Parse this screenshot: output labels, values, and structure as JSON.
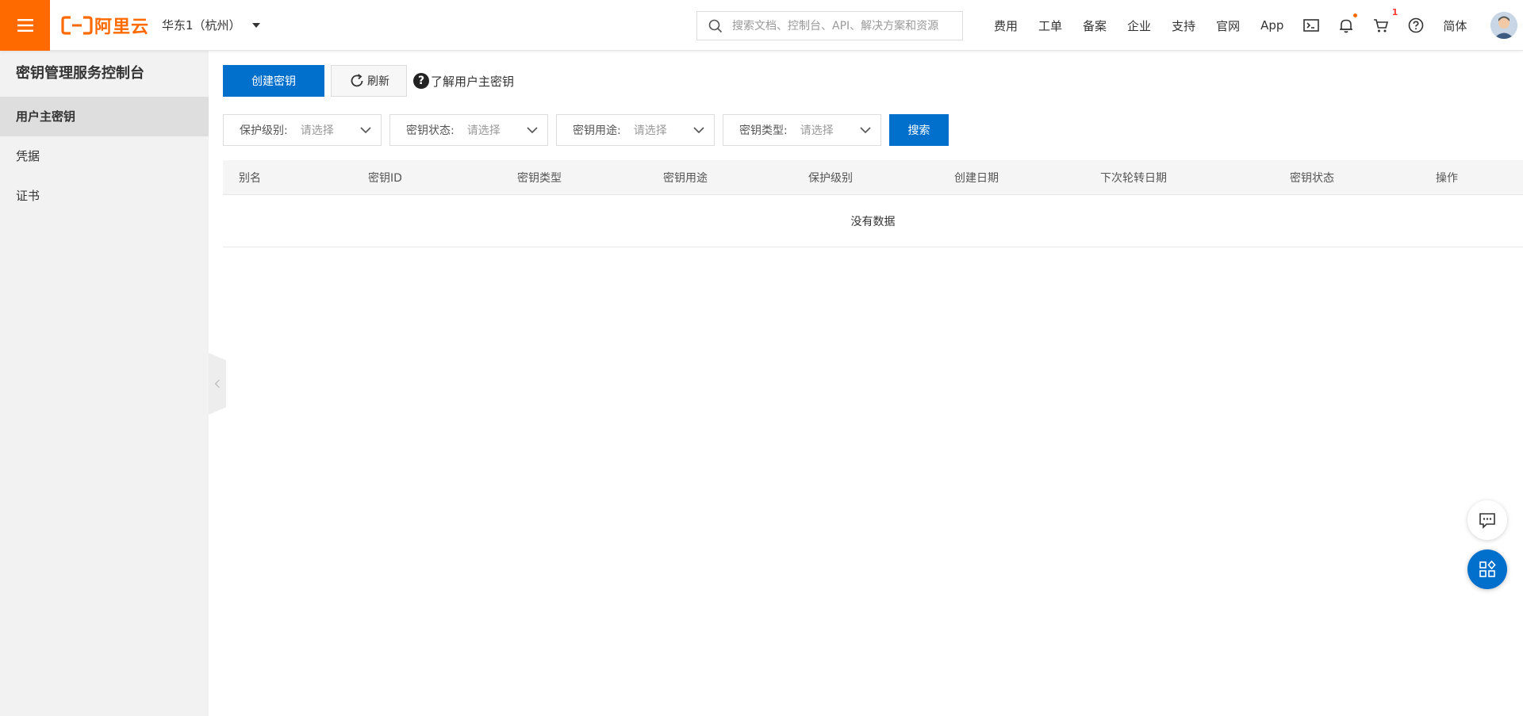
{
  "header": {
    "logo_text": "阿里云",
    "region": "华东1（杭州）",
    "search_placeholder": "搜索文档、控制台、API、解决方案和资源",
    "nav": [
      "费用",
      "工单",
      "备案",
      "企业",
      "支持",
      "官网",
      "App"
    ],
    "cart_count": "1",
    "language": "简体",
    "accent_color": "#ff6a00"
  },
  "sidebar": {
    "title": "密钥管理服务控制台",
    "items": [
      {
        "label": "用户主密钥",
        "active": true
      },
      {
        "label": "凭据",
        "active": false
      },
      {
        "label": "证书",
        "active": false
      }
    ]
  },
  "toolbar": {
    "create_label": "创建密钥",
    "refresh_label": "刷新",
    "help_label": "了解用户主密钥"
  },
  "filters": [
    {
      "label": "保护级别:",
      "value": "请选择"
    },
    {
      "label": "密钥状态:",
      "value": "请选择"
    },
    {
      "label": "密钥用途:",
      "value": "请选择"
    },
    {
      "label": "密钥类型:",
      "value": "请选择"
    }
  ],
  "search_label": "搜索",
  "table": {
    "columns": [
      "别名",
      "密钥ID",
      "密钥类型",
      "密钥用途",
      "保护级别",
      "创建日期",
      "下次轮转日期",
      "密钥状态",
      "操作"
    ],
    "empty_text": "没有数据"
  },
  "colors": {
    "primary": "#0070cc"
  }
}
